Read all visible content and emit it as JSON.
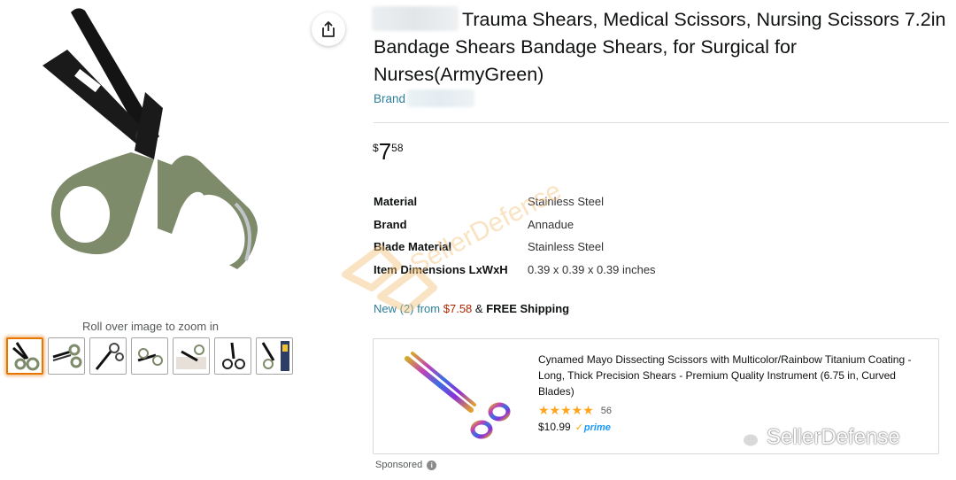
{
  "gallery": {
    "zoom_hint": "Roll over image to zoom in",
    "thumbnails": [
      "thumb-1",
      "thumb-2",
      "thumb-3",
      "thumb-4",
      "thumb-5",
      "thumb-6",
      "thumb-7"
    ],
    "selected_index": 0
  },
  "product": {
    "title": "Trauma Shears, Medical Scissors, Nursing Scissors 7.2in Bandage Shears Bandage Shears, for Surgical for Nurses(ArmyGreen)",
    "brand_label": "Brand",
    "price": {
      "symbol": "$",
      "whole": "7",
      "fraction": "58"
    },
    "specs": [
      {
        "key": "Material",
        "value": "Stainless Steel"
      },
      {
        "key": "Brand",
        "value": "Annadue"
      },
      {
        "key": "Blade Material",
        "value": "Stainless Steel"
      },
      {
        "key": "Item Dimensions LxWxH",
        "value": "0.39 x 0.39 x 0.39 inches"
      }
    ],
    "offers": {
      "new_count_text": "New (2) from",
      "offer_price": "$7.58",
      "amp": "&",
      "shipping": "FREE Shipping"
    }
  },
  "sponsored_ad": {
    "title": "Cynamed Mayo Dissecting Scissors with Multicolor/Rainbow Titanium Coating - Long, Thick Precision Shears - Premium Quality Instrument (6.75 in, Curved Blades)",
    "stars": "★★★★★",
    "rating": 4.7,
    "review_count": "56",
    "price": "$10.99",
    "prime_label": "prime",
    "prime_tick": "✓"
  },
  "sponsored_label": "Sponsored",
  "info_glyph": "i",
  "watermarks": {
    "center": "SellerDefense",
    "corner": "SellerDefense"
  },
  "icons": {
    "share": "share-icon",
    "info": "info-icon",
    "wechat": "wechat-icon"
  },
  "colors": {
    "link": "#2d7f99",
    "price_red": "#b12704",
    "star": "#ffa41c",
    "thumb_selected": "#e77600",
    "scissors_handle": "#7e8b6a",
    "watermark": "#f3c27a"
  }
}
